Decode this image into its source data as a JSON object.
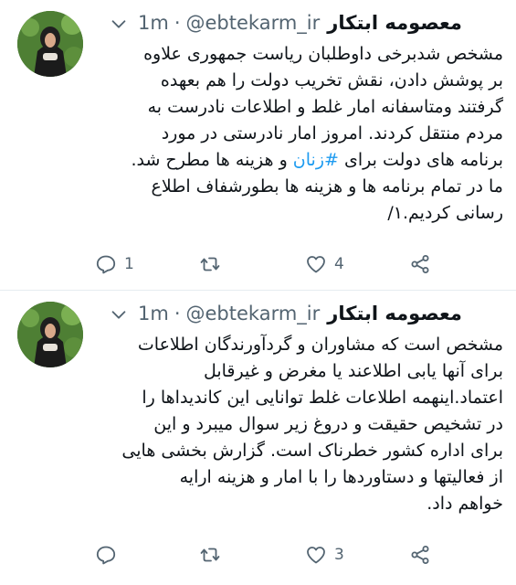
{
  "tweets": [
    {
      "author": {
        "name": "معصومه ابتکار",
        "handle": "@ebtekarm_ir"
      },
      "separator": "·",
      "time": "1m",
      "lines": [
        "مشخص شدبرخی داوطلبان ریاست جمهوری علاوه",
        "بر پوشش دادن، نقش تخریب دولت را هم بعهده",
        "گرفتند ومتاسفانه امار غلط و اطلاعات نادرست به",
        "مردم منتقل کردند. امروز امار نادرستی در مورد",
        "و هزینه ها مطرح شد.",
        "ما در تمام برنامه ها و هزینه ها بطورشفاف اطلاع",
        "رسانی کردیم.۱/"
      ],
      "line5_prefix": "برنامه های دولت برای ",
      "hashtag": "#زنان",
      "replies": "1",
      "retweets": "",
      "likes": "4"
    },
    {
      "author": {
        "name": "معصومه ابتکار",
        "handle": "@ebtekarm_ir"
      },
      "separator": "·",
      "time": "1m",
      "lines": [
        "مشخص است که مشاوران و گردآورندگان اطلاعات",
        "برای آنها یابی اطلاعند یا مغرض و غیرقابل",
        "اعتماد.اینهمه اطلاعات غلط توانایی این کاندیداها را",
        "در تشخیص حقیقت و دروغ زیر سوال میبرد و این",
        "برای اداره کشور خطرناک است. گزارش بخشی هایی",
        "از فعالیتها و دستاوردها را با امار و هزینه ارایه",
        "خواهم داد."
      ],
      "replies": "",
      "retweets": "",
      "likes": "3"
    }
  ],
  "icons": {
    "more": "chevron-down-icon",
    "reply": "reply-icon",
    "retweet": "retweet-icon",
    "like": "heart-icon",
    "share": "share-icon"
  },
  "colors": {
    "text": "#0f1419",
    "secondary": "#536471",
    "link": "#1d9bf0",
    "divider": "#e6ecf0"
  }
}
